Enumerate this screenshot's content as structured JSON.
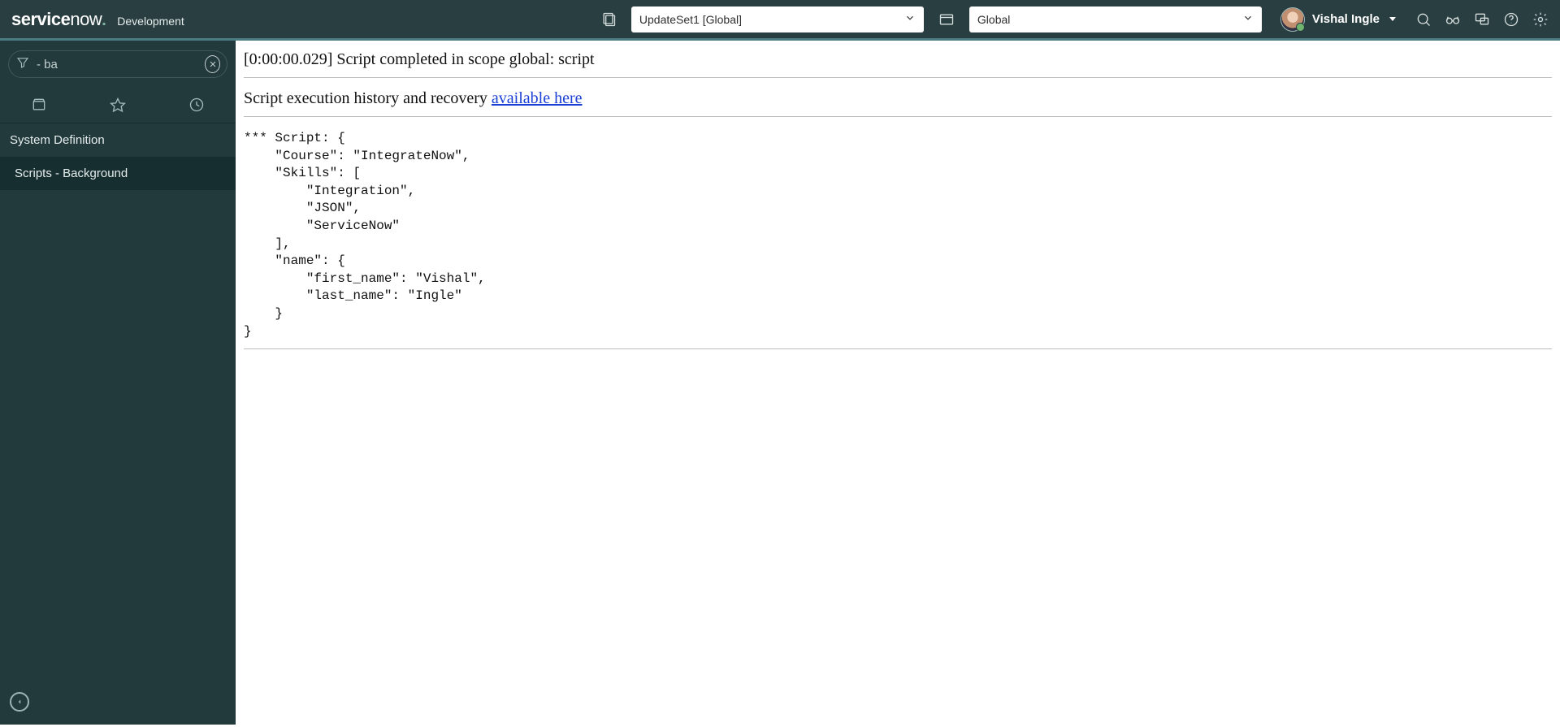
{
  "header": {
    "product": "servicenow",
    "env_label": "Development",
    "update_set": "UpdateSet1 [Global]",
    "application_scope": "Global",
    "user": "Vishal Ingle"
  },
  "sidebar": {
    "filter_value": "- ba",
    "section_label": "System Definition",
    "active_item_label": "Scripts - Background"
  },
  "result": {
    "completion_line": "[0:00:00.029] Script completed in scope global: script",
    "history_prefix": "Script execution history and recovery ",
    "history_link": "available here",
    "script_output": "*** Script: {\n    \"Course\": \"IntegrateNow\",\n    \"Skills\": [\n        \"Integration\",\n        \"JSON\",\n        \"ServiceNow\"\n    ],\n    \"name\": {\n        \"first_name\": \"Vishal\",\n        \"last_name\": \"Ingle\"\n    }\n}"
  }
}
